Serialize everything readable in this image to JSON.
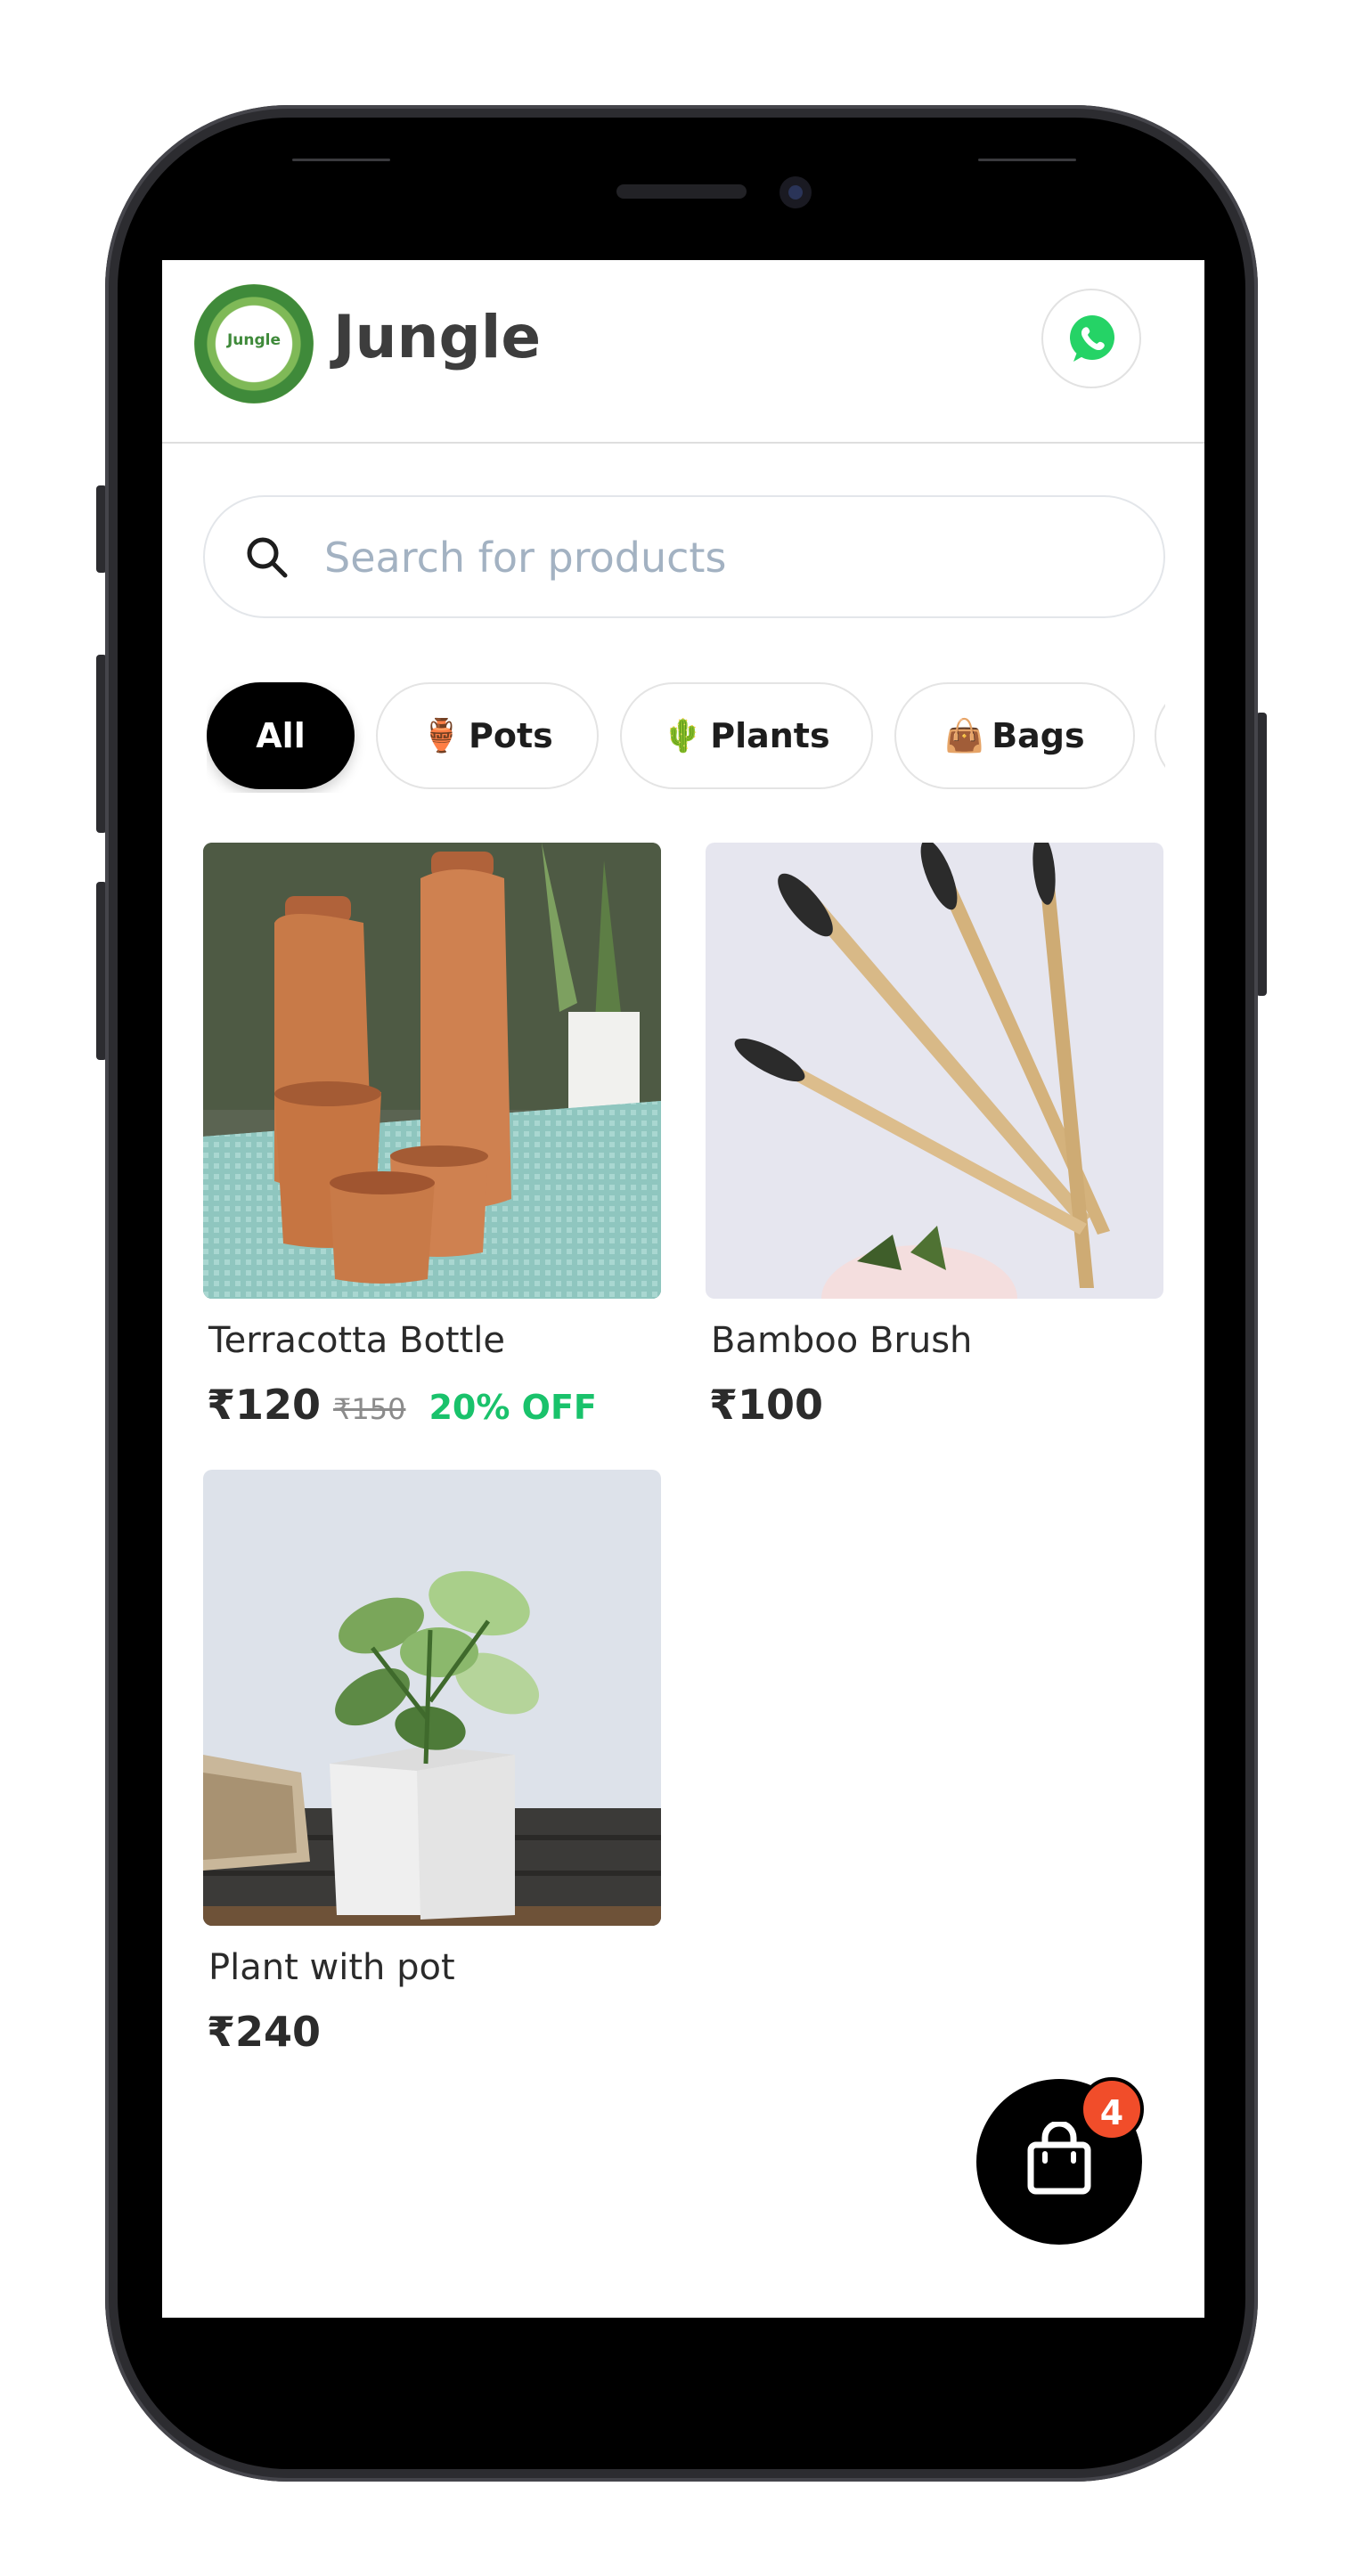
{
  "header": {
    "logo_text": "Jungle",
    "brand": "Jungle",
    "whatsapp_icon": "whatsapp-icon"
  },
  "search": {
    "placeholder": "Search for products",
    "value": ""
  },
  "categories": [
    {
      "label": "All",
      "emoji": "",
      "active": true
    },
    {
      "label": "Pots",
      "emoji": "🏺",
      "active": false
    },
    {
      "label": "Plants",
      "emoji": "🌵",
      "active": false
    },
    {
      "label": "Bags",
      "emoji": "👜",
      "active": false
    }
  ],
  "products": [
    {
      "name": "Terracotta Bottle",
      "price": "₹120",
      "mrp": "₹150",
      "discount": "20% OFF"
    },
    {
      "name": "Bamboo Brush",
      "price": "₹100"
    },
    {
      "name": "Plant with pot",
      "price": "₹240"
    }
  ],
  "cart": {
    "count": "4",
    "icon": "shopping-bag-icon"
  },
  "colors": {
    "accent_green": "#19c26b",
    "badge": "#f14d2a",
    "whatsapp": "#25d366"
  }
}
